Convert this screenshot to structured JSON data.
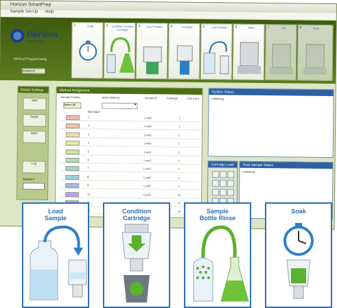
{
  "window": {
    "title": "Horizon SmartPrep",
    "menu": [
      "Sample Set-Up",
      "Help"
    ]
  },
  "brand": {
    "name": "Horizon",
    "subtitle": "Technology",
    "side_text": "Method Programming",
    "side_button": "Advanced"
  },
  "steps": [
    {
      "num": "1",
      "label": "Soak"
    },
    {
      "num": "2",
      "label": "Condition Sorbent Cartridge"
    },
    {
      "num": "3",
      "label": "Load Sample"
    },
    {
      "num": "4",
      "label": "Condition"
    },
    {
      "num": "5",
      "label": "Load Sample"
    },
    {
      "num": "6",
      "label": "Wash"
    },
    {
      "num": "7",
      "label": "Dry"
    },
    {
      "num": "8",
      "label": "Elute"
    }
  ],
  "left_panel": {
    "title": "Global Settings",
    "buttons": [
      "Start",
      "Pause",
      "Abort",
      "Log"
    ],
    "field_label": "Sample #"
  },
  "grid": {
    "title": "Method Assignment",
    "columns": [
      "Sample Position",
      "Select Method",
      "Sample ID",
      "Cartridge",
      "Cart Lot #"
    ],
    "select_all": "Select All",
    "first_option": "Run Sam",
    "rows": [
      {
        "n": "1",
        "id": "Load1",
        "s": "1",
        "color": "#f2b3b3"
      },
      {
        "n": "2",
        "id": "Load1",
        "s": "1",
        "color": "#f1c2a8"
      },
      {
        "n": "3",
        "id": "Load1",
        "s": "1",
        "color": "#f3dca4"
      },
      {
        "n": "4",
        "id": "Load1",
        "s": "1",
        "color": "#eaeb9e"
      },
      {
        "n": "5",
        "id": "Load1",
        "s": "1",
        "color": "#c9e8a4"
      },
      {
        "n": "6",
        "id": "Load1",
        "s": "1",
        "color": "#a9e1b4"
      },
      {
        "n": "7",
        "id": "Load1",
        "s": "1",
        "color": "#9fd9c9"
      },
      {
        "n": "8",
        "id": "Load1",
        "s": "1",
        "color": "#9ecfe1"
      },
      {
        "n": "9",
        "id": "Load1",
        "s": "1",
        "color": "#a3b7e8"
      },
      {
        "n": "10",
        "id": "Load1",
        "s": "10",
        "color": "#b1a7e6"
      },
      {
        "n": "11",
        "id": "Load1",
        "s": "11",
        "color": "#c8a5e2"
      },
      {
        "n": "12",
        "id": "Load1",
        "s": "12",
        "color": "#e0a8d6"
      }
    ]
  },
  "right_panels": {
    "status_title": "System Status",
    "status_text": "Initializing.",
    "keypad_title": "Cartridge Load",
    "log_title": "Total Sample Status",
    "log_text": "Initializing."
  },
  "cards": [
    {
      "title": "Load\nSample",
      "icon": "load-sample-icon"
    },
    {
      "title": "Condition\nCartridge",
      "icon": "condition-cartridge-icon"
    },
    {
      "title": "Sample\nBottle Rinse",
      "icon": "bottle-rinse-icon"
    },
    {
      "title": "Soak",
      "icon": "stopwatch-icon"
    }
  ]
}
